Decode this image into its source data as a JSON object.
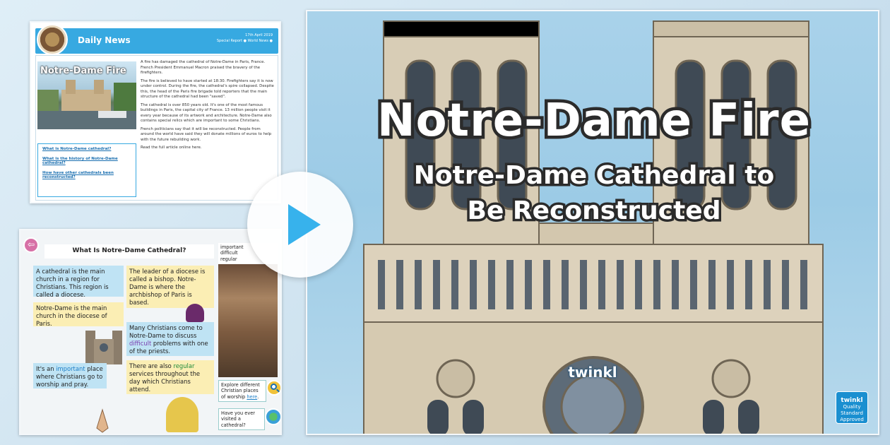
{
  "title_slide": {
    "title": "Notre-Dame Fire",
    "subtitle_line1": "Notre-Dame Cathedral to",
    "subtitle_line2": "Be Reconstructed",
    "logo": "twinkl",
    "badge_title": "twinkl",
    "badge_text": "Quality Standard Approved"
  },
  "play_button": {
    "icon": "play-icon"
  },
  "news_slide": {
    "header_title": "Daily News",
    "date": "17th April 2019",
    "tags": [
      "Special Report",
      "World News"
    ],
    "photo_title": "Notre-Dame Fire",
    "links": [
      "What is Notre-Dame cathedral?",
      "What is the history of Notre-Dame cathedral?",
      "How have other cathedrals been reconstructed?"
    ],
    "paragraphs": [
      "A fire has damaged the cathedral of Notre-Dame in Paris, France. French President Emmanuel Macron praised the bravery of the firefighters.",
      "The fire is believed to have started at 18:30. Firefighters say it is now under control. During the fire, the cathedral's spire collapsed. Despite this, the head of the Paris fire brigade told reporters that the main structure of the cathedral had been \"saved\".",
      "The cathedral is over 850 years old. It's one of the most famous buildings in Paris, the capital city of France. 13 million people visit it every year because of its artwork and architecture. Notre-Dame also contains special relics which are important to some Christians.",
      "French politicians say that it will be reconstructed. People from around the world have said they will donate millions of euros to help with the future rebuilding work.",
      "Read the full article online here."
    ]
  },
  "info_slide": {
    "title": "What Is Notre-Dame Cathedral?",
    "box1": "A cathedral is the main church in a region for Christians. This region is called a diocese.",
    "box2": "Notre-Dame is the main church in the diocese of Paris.",
    "box3_pre": "It's an ",
    "box3_hl": "important",
    "box3_post": " place where Christians go to worship and pray.",
    "box4": "The leader of a diocese is called a bishop. Notre-Dame is where the archbishop of Paris is based.",
    "box5_pre": "Many Christians come to Notre-Dame to discuss ",
    "box5_hl": "difficult",
    "box5_post": " problems with one of the priests.",
    "box6_pre": "There are also ",
    "box6_hl": "regular",
    "box6_post": " services throughout the day which Christians attend.",
    "glossary": [
      "important",
      "difficult",
      "regular"
    ],
    "explore_pre": "Explore different Christian places of worship ",
    "explore_link": "here",
    "explore_post": ".",
    "question": "Have you ever visited a cathedral?"
  }
}
